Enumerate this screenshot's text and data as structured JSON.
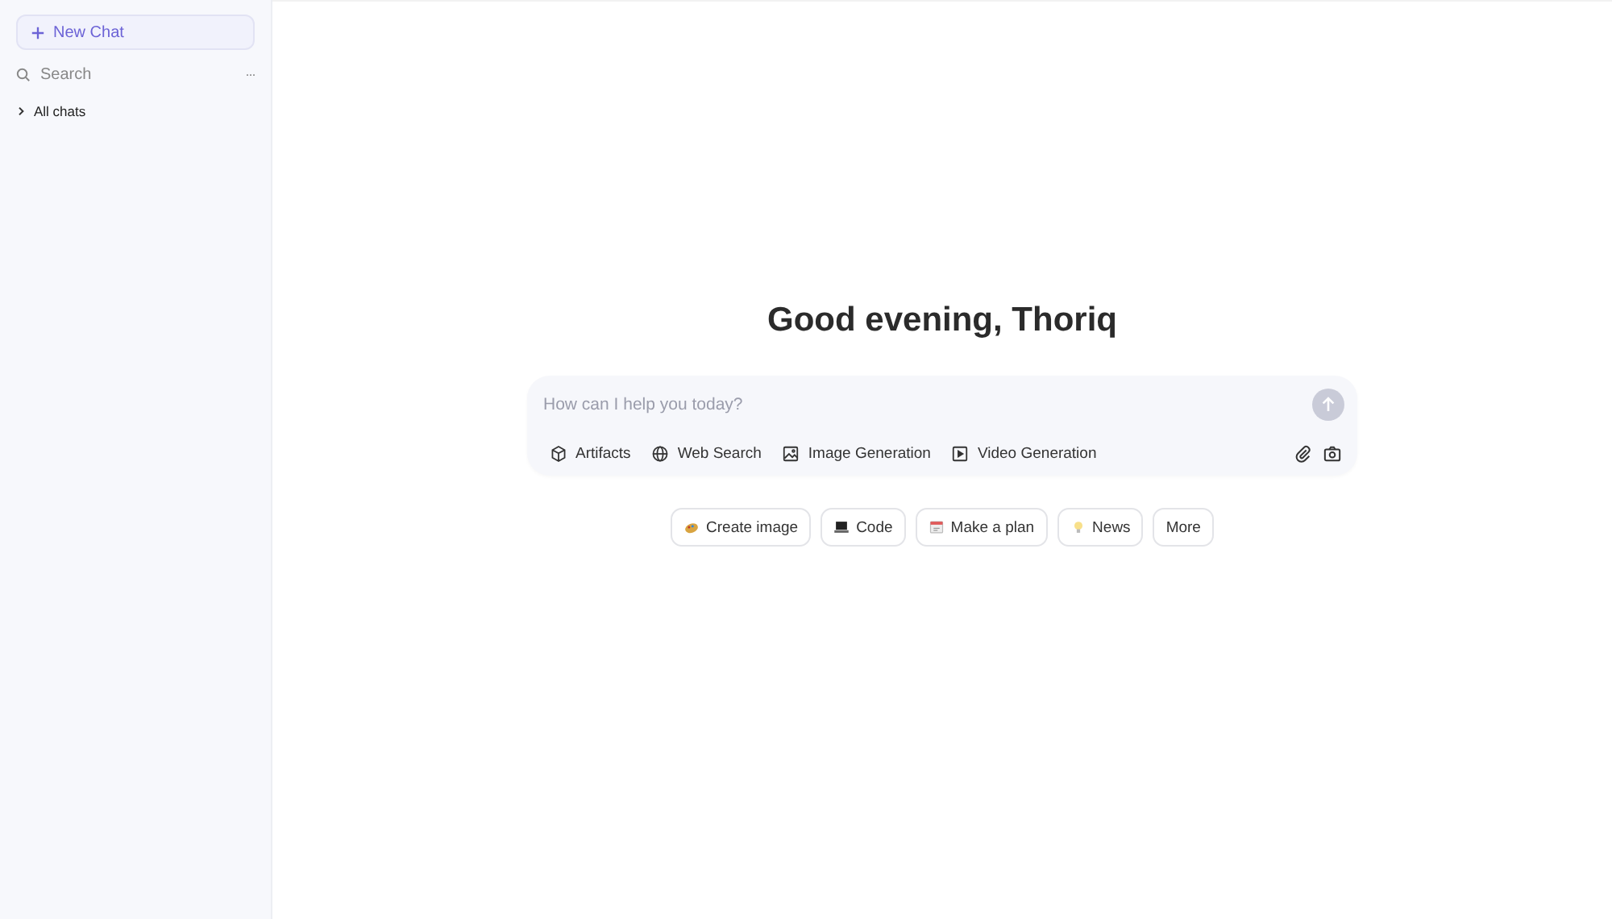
{
  "sidebar": {
    "new_chat": "New Chat",
    "search": {
      "placeholder": "Search"
    },
    "more": "···",
    "sections": [
      {
        "label": "All chats",
        "expanded": false
      }
    ]
  },
  "greeting": "Good evening, Thoriq",
  "composer": {
    "placeholder": "How can I help you today?",
    "tools": [
      "Artifacts",
      "Web Search",
      "Image Generation",
      "Video Generation"
    ]
  },
  "suggestions": [
    "Create image",
    "Code",
    "Make a plan",
    "News",
    "More"
  ]
}
